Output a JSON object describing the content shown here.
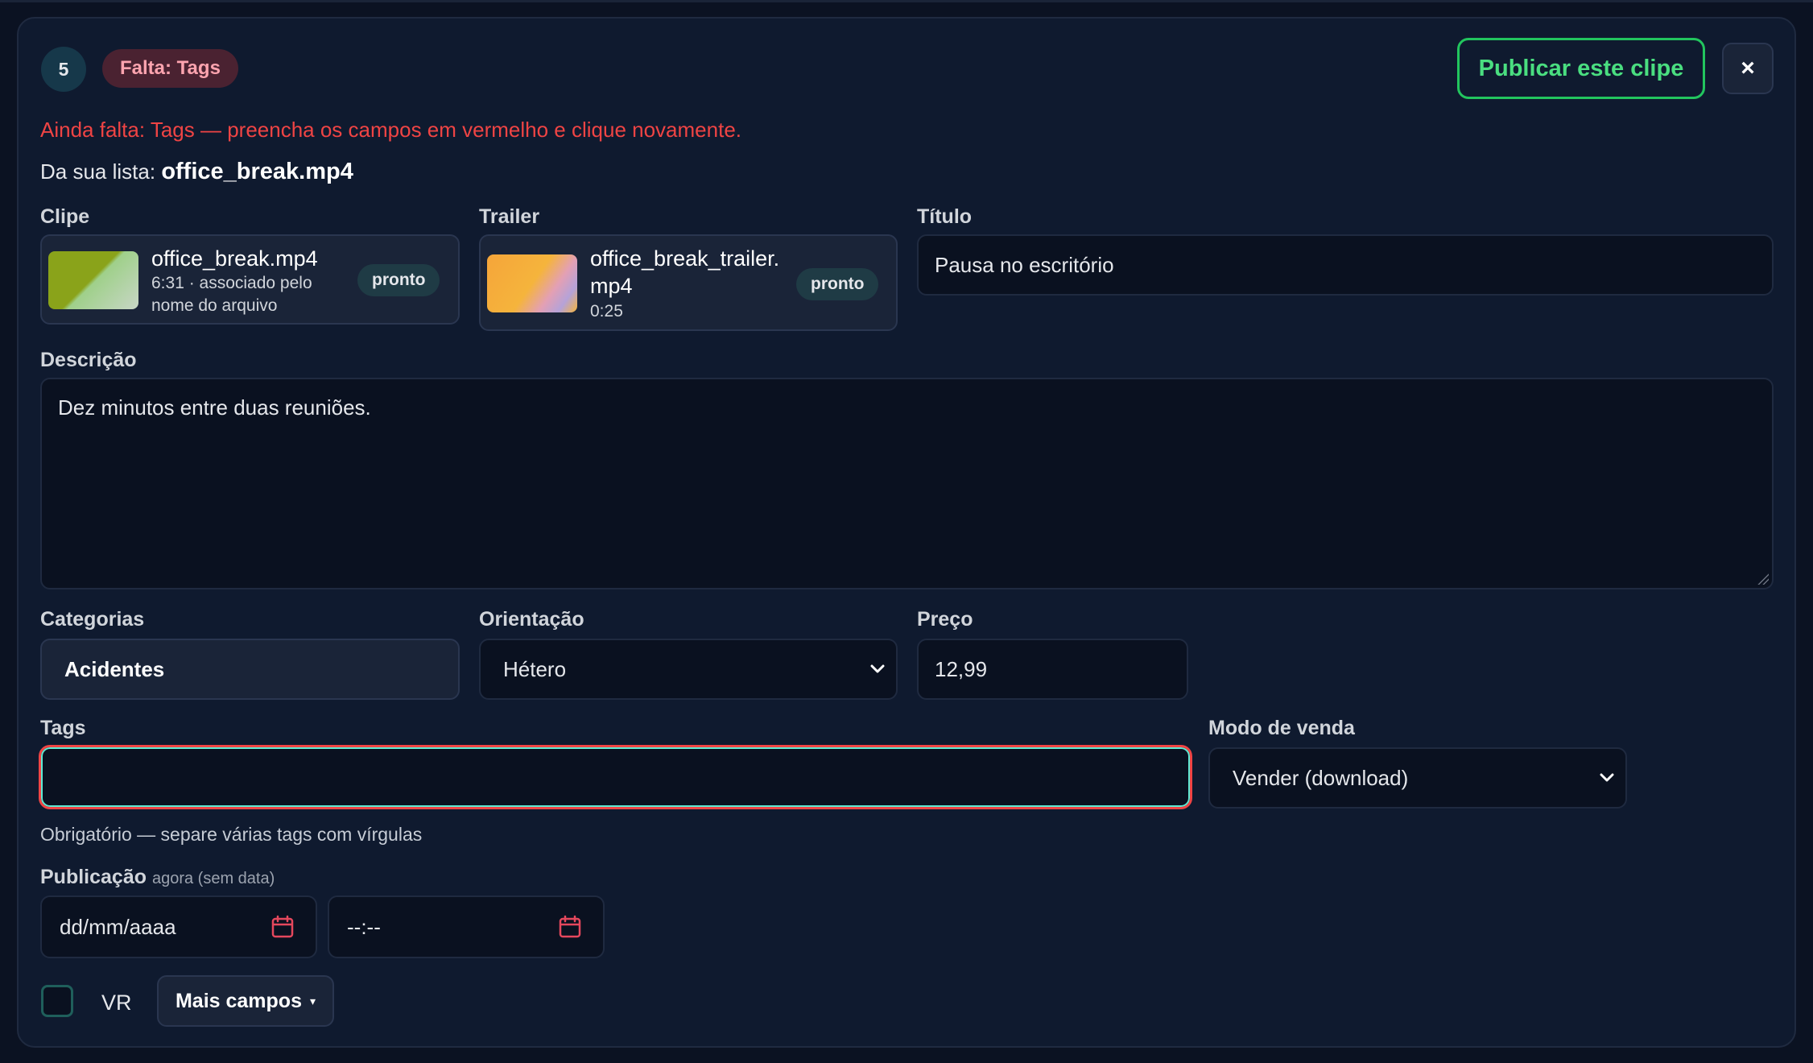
{
  "header": {
    "item_number": "5",
    "missing_badge": "Falta: Tags",
    "publish_label": "Publicar este clipe",
    "close_symbol": "×"
  },
  "error_message": "Ainda falta: Tags — preencha os campos em vermelho e clique novamente.",
  "source": {
    "prefix": "Da sua lista:",
    "filename": "office_break.mp4"
  },
  "clip": {
    "label": "Clipe",
    "filename": "office_break.mp4",
    "meta_line1": "6:31 · associado pelo",
    "meta_line2": "nome do arquivo",
    "status": "pronto"
  },
  "trailer": {
    "label": "Trailer",
    "filename_line1": "office_break_trailer.",
    "filename_line2": "mp4",
    "duration": "0:25",
    "status": "pronto"
  },
  "title_field": {
    "label": "Título",
    "value": "Pausa no escritório"
  },
  "description_field": {
    "label": "Descrição",
    "value": "Dez minutos entre duas reuniões."
  },
  "categories": {
    "label": "Categorias",
    "value": "Acidentes"
  },
  "orientation": {
    "label": "Orientação",
    "value": "Hétero"
  },
  "price": {
    "label": "Preço",
    "value": "12,99"
  },
  "tags": {
    "label": "Tags",
    "value": "",
    "hint": "Obrigatório — separe várias tags com vírgulas"
  },
  "sale_mode": {
    "label": "Modo de venda",
    "value": "Vender (download)"
  },
  "publication": {
    "label": "Publicação",
    "sublabel": "agora (sem data)",
    "date_placeholder": "dd/mm/aaaa",
    "time_placeholder": "--:--"
  },
  "vr": {
    "label": "VR",
    "checked": false
  },
  "more_fields": {
    "label": "Mais campos",
    "caret": "▾"
  },
  "colors": {
    "background": "#0f1a2f",
    "error": "#ef4444",
    "publish_accent": "#22c55e",
    "badge_missing_bg": "#4a2231",
    "badge_missing_text": "#fda4af"
  }
}
